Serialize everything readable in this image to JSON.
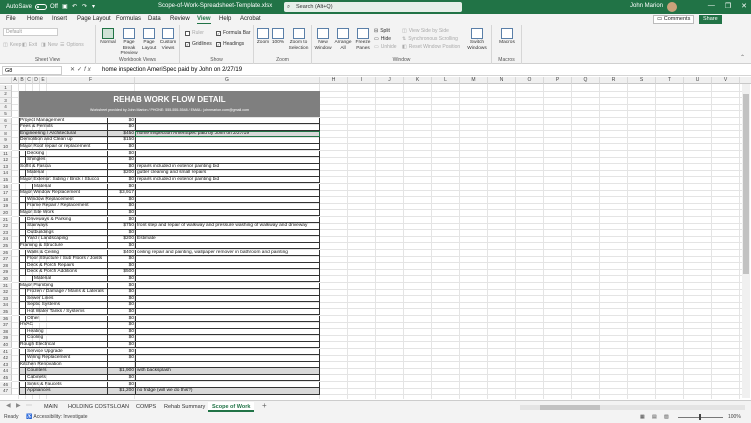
{
  "titlebar": {
    "autosave_label": "AutoSave",
    "autosave_state": "Off",
    "document_title": "Scope-of-Work-Spreadsheet-Template.xlsx",
    "search_placeholder": "Search (Alt+Q)",
    "user_name": "John Marion",
    "min": "—",
    "max": "❐",
    "close": "✕"
  },
  "menu": {
    "tabs": [
      "File",
      "Home",
      "Insert",
      "Page Layout",
      "Formulas",
      "Data",
      "Review",
      "View",
      "Help",
      "Acrobat"
    ],
    "active": "View",
    "comments_label": "Comments",
    "share_label": "Share"
  },
  "ribbon": {
    "sheet_view": {
      "label": "Sheet View",
      "dropdown": "Default",
      "buttons": [
        "Keep",
        "Exit",
        "New",
        "Options"
      ]
    },
    "workbook_views": {
      "label": "Workbook Views",
      "buttons": [
        "Normal",
        "Page Break Preview",
        "Page Layout",
        "Custom Views"
      ]
    },
    "show": {
      "label": "Show",
      "items": [
        {
          "name": "Ruler",
          "checked": false,
          "disabled": true
        },
        {
          "name": "Gridlines",
          "checked": true,
          "disabled": false
        },
        {
          "name": "Formula Bar",
          "checked": true,
          "disabled": false
        },
        {
          "name": "Headings",
          "checked": true,
          "disabled": false
        }
      ]
    },
    "zoom": {
      "label": "Zoom",
      "buttons": [
        "Zoom",
        "100%",
        "Zoom to Selection"
      ]
    },
    "window": {
      "label": "Window",
      "buttons": [
        "New Window",
        "Arrange All",
        "Freeze Panes"
      ],
      "small": [
        "Split",
        "Hide",
        "Unhide"
      ],
      "side": [
        "View Side by Side",
        "Synchronous Scrolling",
        "Reset Window Position"
      ],
      "switch": "Switch Windows"
    },
    "macros": {
      "label": "Macros",
      "button": "Macros"
    }
  },
  "formula_bar": {
    "name_box": "G8",
    "fx": "fx",
    "formula": "home inspection AmeriSpec paid by John on 2/27/19"
  },
  "columns": [
    "A",
    "B",
    "C",
    "D",
    "E",
    "F",
    "G",
    "H",
    "I",
    "J",
    "K",
    "L",
    "M",
    "N",
    "O",
    "P",
    "Q",
    "R",
    "S",
    "T",
    "U",
    "V",
    "W",
    "X",
    "Y"
  ],
  "sheet": {
    "title": "REHAB WORK FLOW DETAIL",
    "subtitle": "Worksheet provided by John Marion  /  PHONE: 555-555-5548  /  EMAIL: johnmarion.com@gmail.com",
    "rows": [
      {
        "r": "1",
        "label": "",
        "amt": "",
        "note": "",
        "indent": 0,
        "shade": false
      },
      {
        "r": "2",
        "label": "",
        "amt": "",
        "note": "",
        "indent": 0,
        "shade": false
      },
      {
        "r": "3",
        "label": "",
        "amt": "",
        "note": "",
        "indent": 0,
        "shade": false
      },
      {
        "r": "4",
        "label": "",
        "amt": "",
        "note": "",
        "indent": 0,
        "shade": false
      },
      {
        "r": "5",
        "label": "",
        "amt": "",
        "note": "",
        "indent": 0,
        "shade": false
      },
      {
        "r": "6",
        "label": "Project Management",
        "amt": "$0",
        "note": "",
        "indent": 0,
        "shade": false
      },
      {
        "r": "7",
        "label": "Fees & Permits",
        "amt": "$0",
        "note": "",
        "indent": 0,
        "shade": false
      },
      {
        "r": "8",
        "label": "Engineering / Architectural",
        "amt": "$450",
        "note": "home inspection AmeriSpec paid by John on 2/27/19",
        "indent": 0,
        "shade": true
      },
      {
        "r": "9",
        "label": "Demolition and Clean up",
        "amt": "$150",
        "note": "",
        "indent": 0,
        "shade": false
      },
      {
        "r": "10",
        "label": "Major Roof repair or replacement",
        "amt": "$0",
        "note": "",
        "indent": 0,
        "shade": false
      },
      {
        "r": "11",
        "label": "Decking",
        "amt": "$0",
        "note": "",
        "indent": 1,
        "shade": false
      },
      {
        "r": "12",
        "label": "Shingles",
        "amt": "$0",
        "note": "",
        "indent": 1,
        "shade": false
      },
      {
        "r": "13",
        "label": "Soffit & Fascia",
        "amt": "$0",
        "note": "repairs included in exterior painting bid",
        "indent": 0,
        "shade": false
      },
      {
        "r": "14",
        "label": "Material",
        "amt": "$200",
        "note": "gutter cleaning and small repairs",
        "indent": 1,
        "shade": false
      },
      {
        "r": "15",
        "label": "Major Exterior: Siding / Brick / Stucco",
        "amt": "$0",
        "note": "repairs included in exterior painting bid",
        "indent": 0,
        "shade": false
      },
      {
        "r": "16",
        "label": "Material",
        "amt": "$0",
        "note": "",
        "indent": 2,
        "shade": false
      },
      {
        "r": "17",
        "label": "Major Window Replacement",
        "amt": "$3,917",
        "note": "",
        "indent": 0,
        "shade": false
      },
      {
        "r": "18",
        "label": "Window Replacement",
        "amt": "$0",
        "note": "",
        "indent": 1,
        "shade": false
      },
      {
        "r": "19",
        "label": "Frame Repair / Replacement",
        "amt": "$0",
        "note": "",
        "indent": 1,
        "shade": false
      },
      {
        "r": "20",
        "label": "Major Site Work",
        "amt": "$0",
        "note": "",
        "indent": 0,
        "shade": false
      },
      {
        "r": "21",
        "label": "Driveways & Parking",
        "amt": "$0",
        "note": "",
        "indent": 1,
        "shade": false
      },
      {
        "r": "22",
        "label": "Stairways",
        "amt": "$750",
        "note": "front step and repair of walkway and pressure washing of walkway and driveway",
        "indent": 1,
        "shade": false
      },
      {
        "r": "23",
        "label": "Outbuildings",
        "amt": "$0",
        "note": "",
        "indent": 1,
        "shade": false
      },
      {
        "r": "24",
        "label": "Yard / Landscaping",
        "amt": "$200",
        "note": "Estimate",
        "indent": 1,
        "shade": false
      },
      {
        "r": "25",
        "label": "Framing & Structure",
        "amt": "$0",
        "note": "",
        "indent": 0,
        "shade": false
      },
      {
        "r": "26",
        "label": "Walls & Ceiling",
        "amt": "$400",
        "note": "ceiling repair and painting, wallpaper remover in bathroom and painting",
        "indent": 1,
        "shade": false
      },
      {
        "r": "27",
        "label": "Floor Structure / Sub Floors / Joists",
        "amt": "$0",
        "note": "",
        "indent": 1,
        "shade": false
      },
      {
        "r": "28",
        "label": "Deck & Porch Repairs",
        "amt": "$0",
        "note": "",
        "indent": 1,
        "shade": false
      },
      {
        "r": "29",
        "label": "Deck & Porch Additions",
        "amt": "$500",
        "note": "",
        "indent": 1,
        "shade": false
      },
      {
        "r": "30",
        "label": "Material",
        "amt": "$0",
        "note": "",
        "indent": 2,
        "shade": false
      },
      {
        "r": "31",
        "label": "Major Plumbing",
        "amt": "$0",
        "note": "",
        "indent": 0,
        "shade": false
      },
      {
        "r": "32",
        "label": "Frozen / Damage / Mains & Laterals",
        "amt": "$0",
        "note": "",
        "indent": 1,
        "shade": false
      },
      {
        "r": "33",
        "label": "Sewer Lines",
        "amt": "$0",
        "note": "",
        "indent": 1,
        "shade": false
      },
      {
        "r": "34",
        "label": "Septic Systems",
        "amt": "$0",
        "note": "",
        "indent": 1,
        "shade": false
      },
      {
        "r": "35",
        "label": "Hot Water Tanks / Systems",
        "amt": "$0",
        "note": "",
        "indent": 1,
        "shade": false
      },
      {
        "r": "36",
        "label": "Other",
        "amt": "$0",
        "note": "",
        "indent": 1,
        "shade": false
      },
      {
        "r": "37",
        "label": "HVAC",
        "amt": "$0",
        "note": "",
        "indent": 0,
        "shade": false
      },
      {
        "r": "38",
        "label": "Heating",
        "amt": "$0",
        "note": "",
        "indent": 1,
        "shade": false
      },
      {
        "r": "39",
        "label": "Cooling",
        "amt": "$0",
        "note": "",
        "indent": 1,
        "shade": false
      },
      {
        "r": "40",
        "label": "Rough Electrical",
        "amt": "$0",
        "note": "",
        "indent": 0,
        "shade": false
      },
      {
        "r": "41",
        "label": "Service Upgrade",
        "amt": "$0",
        "note": "",
        "indent": 1,
        "shade": false
      },
      {
        "r": "42",
        "label": "Wiring Replacement",
        "amt": "$0",
        "note": "",
        "indent": 1,
        "shade": false
      },
      {
        "r": "43",
        "label": "Kitchen Renovation",
        "amt": "",
        "note": "",
        "indent": 0,
        "shade": false
      },
      {
        "r": "44",
        "label": "Counters",
        "amt": "$1,900",
        "note": "with backsplash",
        "indent": 1,
        "shade": true
      },
      {
        "r": "45",
        "label": "Cabinets",
        "amt": "$0",
        "note": "",
        "indent": 1,
        "shade": false
      },
      {
        "r": "46",
        "label": "Sinks & Faucets",
        "amt": "$0",
        "note": "",
        "indent": 1,
        "shade": false
      },
      {
        "r": "47",
        "label": "Appliances",
        "amt": "$1,200",
        "note": "no fridge (will we do this?)",
        "indent": 1,
        "shade": true
      }
    ]
  },
  "sheet_tabs": {
    "tabs": [
      "MAIN",
      "HOLDING COSTS",
      "LOAN",
      "COMPS",
      "Rehab Summary",
      "Scope of Work"
    ],
    "active": "Scope of Work",
    "add": "+"
  },
  "status": {
    "ready": "Ready",
    "accessibility": "Accessibility: Investigate",
    "zoom": "100%"
  },
  "colors": {
    "accent": "#217346",
    "banner": "#7f7f7f",
    "shade": "#d9d9d9"
  }
}
